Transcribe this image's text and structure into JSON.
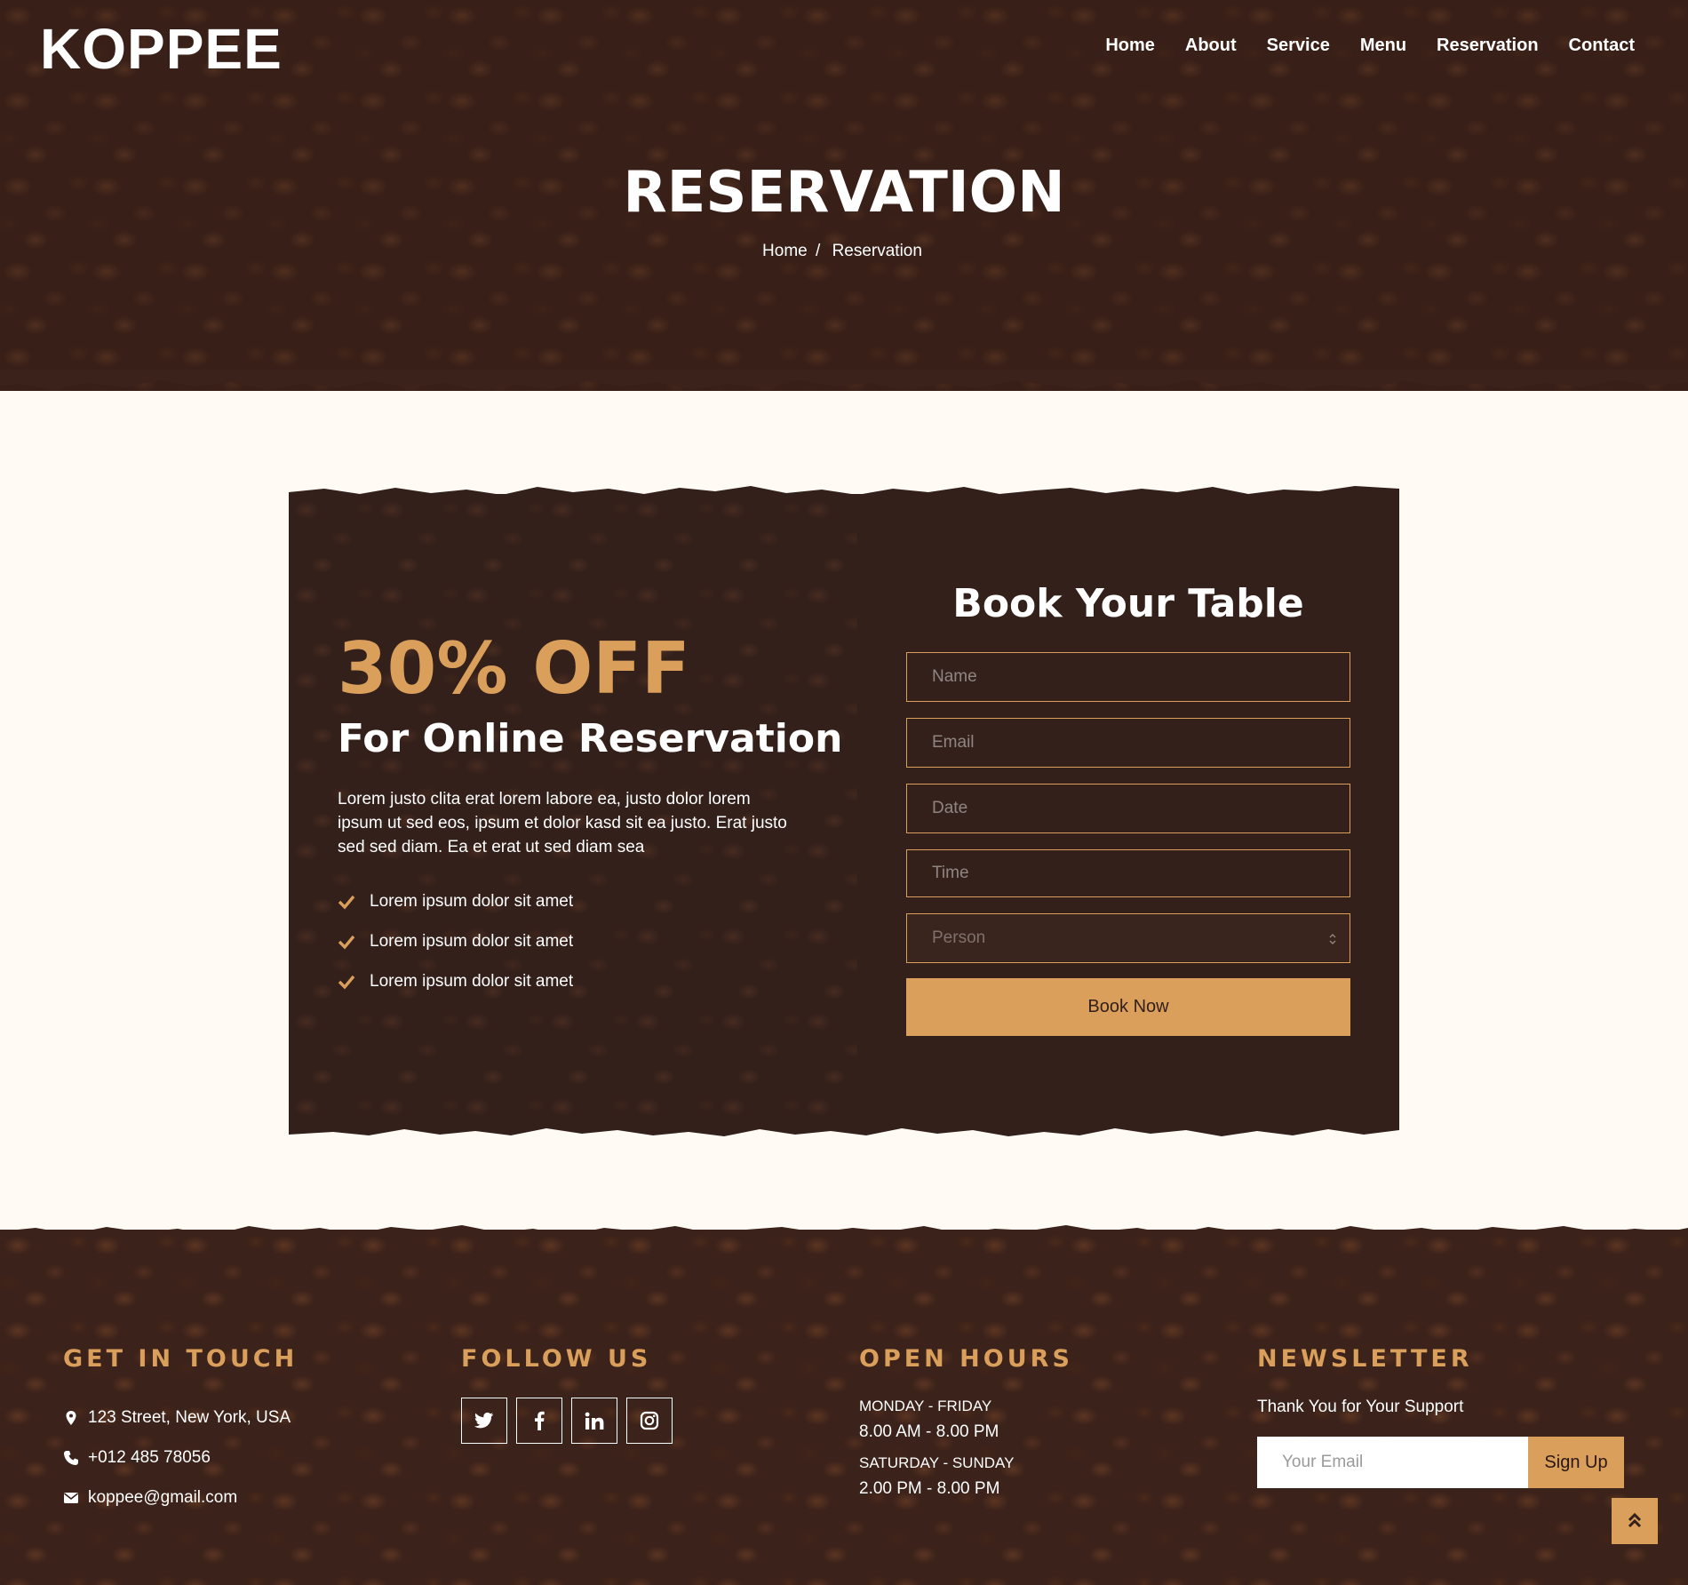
{
  "brand": {
    "logo": "KOPPEE"
  },
  "nav": {
    "items": [
      "Home",
      "About",
      "Service",
      "Menu",
      "Reservation",
      "Contact"
    ]
  },
  "hero": {
    "title": "RESERVATION",
    "breadcrumb": {
      "home": "Home",
      "separator": "/",
      "current": "Reservation"
    }
  },
  "offer": {
    "headline": "30% OFF",
    "subheadline": "For Online Reservation",
    "description": "Lorem justo clita erat lorem labore ea, justo dolor lorem ipsum ut sed eos, ipsum et dolor kasd sit ea justo. Erat justo sed sed diam. Ea et erat ut sed diam sea",
    "features": [
      "Lorem ipsum dolor sit amet",
      "Lorem ipsum dolor sit amet",
      "Lorem ipsum dolor sit amet"
    ]
  },
  "booking": {
    "title": "Book Your Table",
    "name_placeholder": "Name",
    "email_placeholder": "Email",
    "date_placeholder": "Date",
    "time_placeholder": "Time",
    "person_placeholder": "Person",
    "submit_label": "Book Now"
  },
  "footer": {
    "contact": {
      "title": "GET IN TOUCH",
      "address": "123 Street, New York, USA",
      "phone": "+012 485 78056",
      "email": "koppee@gmail.com"
    },
    "follow": {
      "title": "FOLLOW US",
      "icons": [
        "twitter-icon",
        "facebook-icon",
        "linkedin-icon",
        "instagram-icon"
      ]
    },
    "hours": {
      "title": "OPEN HOURS",
      "weekday_label": "MONDAY - FRIDAY",
      "weekday_time": "8.00 AM - 8.00 PM",
      "weekend_label": "SATURDAY - SUNDAY",
      "weekend_time": "2.00 PM - 8.00 PM"
    },
    "newsletter": {
      "title": "NEWSLETTER",
      "text": "Thank You for Your Support",
      "email_placeholder": "Your Email",
      "button_label": "Sign Up"
    }
  },
  "colors": {
    "accent": "#da9f5b",
    "dark": "#33201b",
    "cream": "#fffaf3"
  }
}
